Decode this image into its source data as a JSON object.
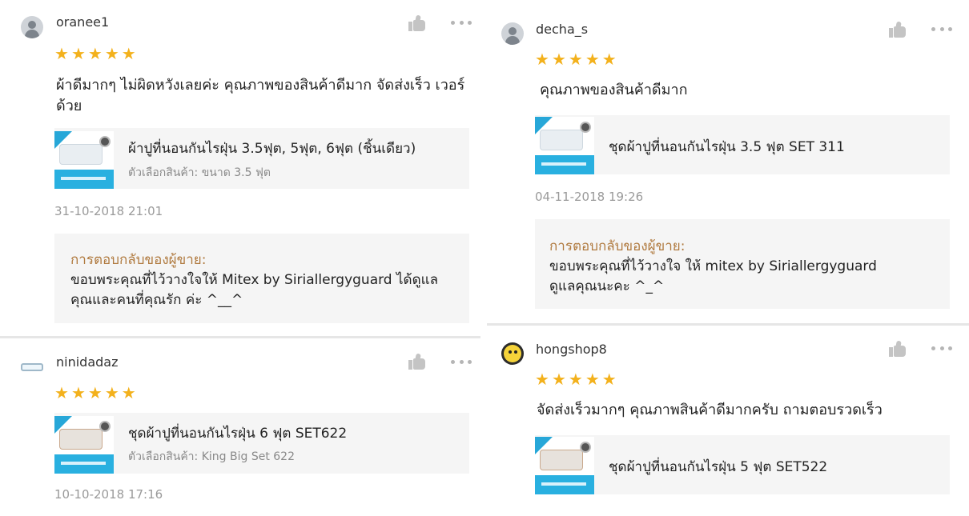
{
  "star_color": "#f3b11c",
  "reply_label_color": "#b07a3f",
  "reviews": [
    {
      "username": "oranee1",
      "avatar_icon": "user-avatar-icon",
      "stars": [
        "★",
        "★",
        "★",
        "★",
        "★"
      ],
      "comment": "ผ้าดีมากๆ ไม่ผิดหวังเลยค่ะ  คุณภาพของสินค้าดีมาก จัดส่งเร็ว เวอร์ด้วย",
      "product_title": "ผ้าปูที่นอนกันไรฝุ่น 3.5ฟุต, 5ฟุต, 6ฟุต (ชิ้นเดียว)",
      "product_option": "ตัวเลือกสินค้า: ขนาด 3.5 ฟุต",
      "timestamp": "31-10-2018 21:01",
      "reply_label": "การตอบกลับของผู้ขาย:",
      "reply_text": "ขอบพระคุณที่ไว้วางใจให้ Mitex by Siriallergyguard ได้ดูแล คุณและคนที่คุณรัก ค่ะ ^__^"
    },
    {
      "username": "ninidadaz",
      "avatar_icon": "product-avatar-icon",
      "stars": [
        "★",
        "★",
        "★",
        "★",
        "★"
      ],
      "product_title": "ชุดผ้าปูที่นอนกันไรฝุ่น 6 ฟุต SET622",
      "product_option": "ตัวเลือกสินค้า: King Big Set 622",
      "timestamp": "10-10-2018 17:16"
    },
    {
      "username": "decha_s",
      "avatar_icon": "user-avatar-icon",
      "stars": [
        "★",
        "★",
        "★",
        "★",
        "★"
      ],
      "comment": "คุณภาพของสินค้าดีมาก",
      "product_title": "ชุดผ้าปูที่นอนกันไรฝุ่น 3.5 ฟุต SET 311",
      "timestamp": "04-11-2018 19:26",
      "reply_label": "การตอบกลับของผู้ขาย:",
      "reply_text_line1": "ขอบพระคุณที่ไว้วางใจ ให้ mitex by Siriallergyguard",
      "reply_text_line2": "ดูแลคุณนะคะ ^_^"
    },
    {
      "username": "hongshop8",
      "avatar_icon": "cartoon-avatar-icon",
      "stars": [
        "★",
        "★",
        "★",
        "★",
        "★"
      ],
      "comment": "จัดส่งเร็วมากๆ คุณภาพสินค้าดีมากครับ ถามตอบรวดเร็ว",
      "product_title": "ชุดผ้าปูที่นอนกันไรฝุ่น 5 ฟุต SET522"
    }
  ]
}
